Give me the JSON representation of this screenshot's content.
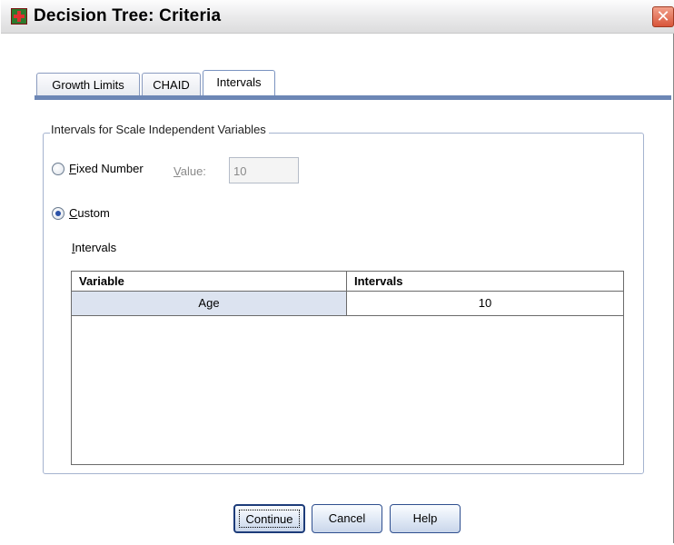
{
  "window": {
    "title": "Decision Tree: Criteria",
    "close_glyph": "✕"
  },
  "tabs": [
    {
      "label": "Growth Limits",
      "active": false
    },
    {
      "label": "CHAID",
      "active": false
    },
    {
      "label": "Intervals",
      "active": true
    }
  ],
  "group": {
    "legend": "Intervals for Scale Independent Variables"
  },
  "fixed_number": {
    "label_underlined": "F",
    "label_rest": "ixed Number",
    "selected": false,
    "value_label_underlined": "V",
    "value_label_rest": "alue:",
    "value": "10"
  },
  "custom": {
    "label_underlined": "C",
    "label_rest": "ustom",
    "selected": true
  },
  "intervals": {
    "label_underlined": "I",
    "label_rest": "ntervals",
    "columns": [
      "Variable",
      "Intervals"
    ],
    "rows": [
      {
        "variable": "Age",
        "intervals": "10"
      }
    ]
  },
  "buttons": {
    "continue": "Continue",
    "cancel": "Cancel",
    "help": "Help"
  },
  "colors": {
    "accent": "#6d87b5",
    "selected_row": "#dce3f0"
  }
}
